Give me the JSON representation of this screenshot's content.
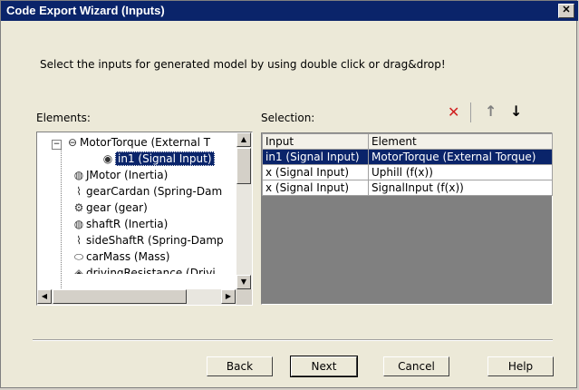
{
  "window": {
    "title": "Code Export Wizard  (Inputs)",
    "close_label": "✕"
  },
  "instruction": "Select the inputs for generated model by using double click or drag&drop!",
  "elements_label": "Elements:",
  "selection_label": "Selection:",
  "tree": {
    "items": [
      {
        "label": "MotorTorque (External T",
        "icon": "external-torque-icon",
        "expanded_marker": "−"
      },
      {
        "label": "in1 (Signal Input)",
        "icon": "signal-input-icon",
        "selected": true
      },
      {
        "label": "JMotor (Inertia)",
        "icon": "inertia-icon"
      },
      {
        "label": "gearCardan (Spring-Dam",
        "icon": "spring-damper-icon"
      },
      {
        "label": "gear (gear)",
        "icon": "gear-icon"
      },
      {
        "label": "shaftR (Inertia)",
        "icon": "inertia-icon"
      },
      {
        "label": "sideShaftR (Spring-Damp",
        "icon": "spring-damper-icon"
      },
      {
        "label": "carMass (Mass)",
        "icon": "mass-icon"
      },
      {
        "label": "drivingResistance (Drivi",
        "icon": "resistance-icon"
      }
    ]
  },
  "selection_table": {
    "columns": [
      "Input",
      "Element"
    ],
    "rows": [
      {
        "input": "in1 (Signal Input)",
        "element": "MotorTorque (External Torque)",
        "active": true
      },
      {
        "input": "x (Signal Input)",
        "element": "Uphill (f(x))"
      },
      {
        "input": "x (Signal Input)",
        "element": "SignalInput (f(x))"
      }
    ]
  },
  "toolbar": {
    "delete_glyph": "✕",
    "up_glyph": "↑",
    "down_glyph": "↓"
  },
  "buttons": {
    "back": "Back",
    "next": "Next",
    "cancel": "Cancel",
    "help": "Help"
  }
}
